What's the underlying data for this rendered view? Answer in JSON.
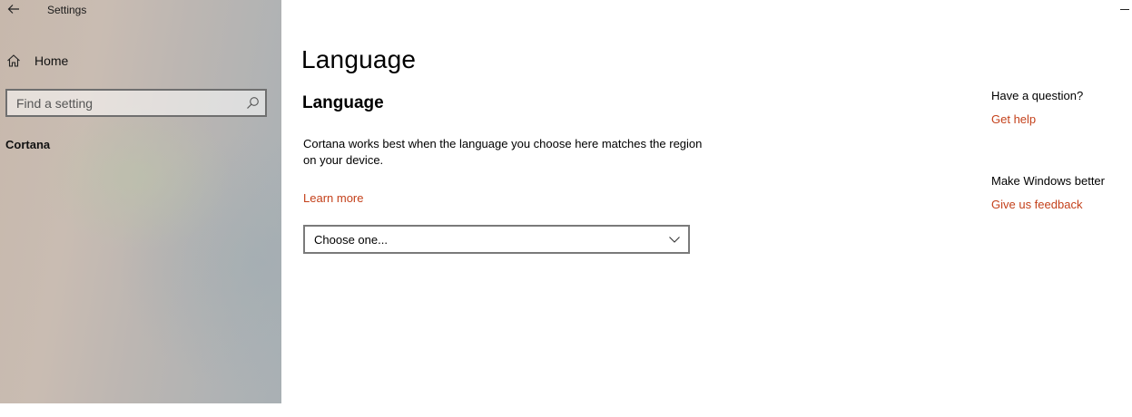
{
  "window": {
    "app_title": "Settings"
  },
  "sidebar": {
    "home_label": "Home",
    "search": {
      "placeholder": "Find a setting",
      "value": ""
    },
    "section_label": "Cortana"
  },
  "main": {
    "page_title": "Language",
    "section_title": "Language",
    "description": "Cortana works best when the language you choose here matches the region on your device.",
    "learn_more": "Learn more",
    "dropdown": {
      "selected": "Choose one..."
    }
  },
  "aside": {
    "question_heading": "Have a question?",
    "get_help": "Get help",
    "improve_heading": "Make Windows better",
    "feedback": "Give us feedback"
  },
  "colors": {
    "link": "#c4411b",
    "border": "#7a7a7a"
  },
  "icons": {
    "back": "back-arrow-icon",
    "home": "home-icon",
    "search": "search-icon",
    "dropdown": "chevron-down-icon",
    "minimize": "minimize-icon"
  }
}
